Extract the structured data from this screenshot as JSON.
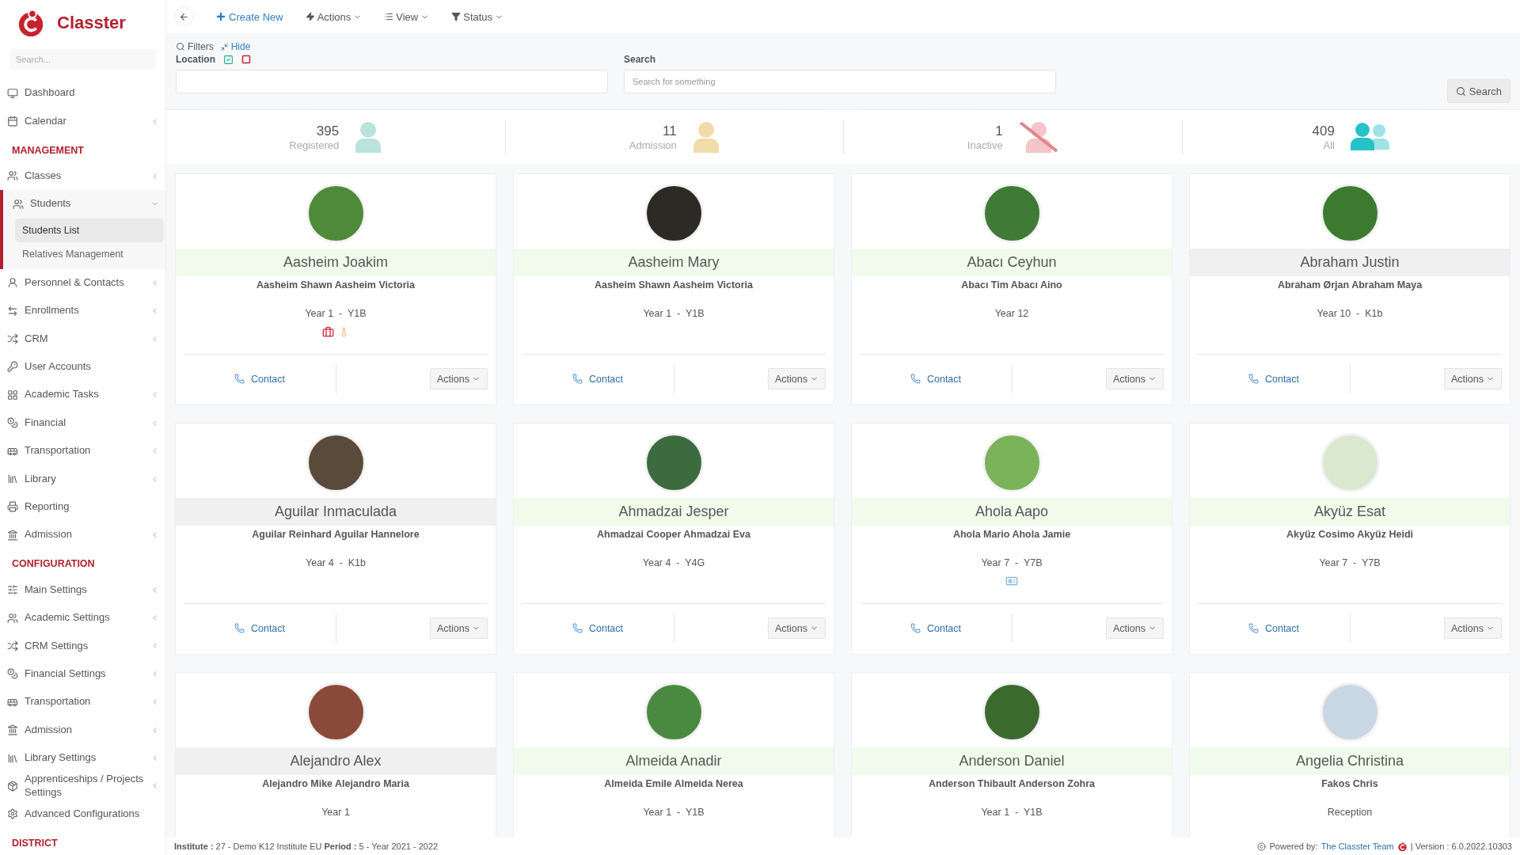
{
  "sidebar": {
    "brand": "Classter",
    "search_placeholder": "Search...",
    "sections": [
      {
        "items": [
          {
            "label": "Dashboard",
            "selected": false
          },
          {
            "label": "Calendar",
            "selected": false,
            "expanded": false
          }
        ]
      },
      {
        "heading": "MANAGEMENT",
        "items": [
          {
            "label": "Classes",
            "selected": false,
            "expanded": false
          },
          {
            "label": "Students",
            "selected": true,
            "expanded": true,
            "children": [
              {
                "label": "Students List",
                "selected": true
              },
              {
                "label": "Relatives Management",
                "selected": false
              }
            ]
          },
          {
            "label": "Personnel & Contacts",
            "selected": false,
            "expanded": false
          },
          {
            "label": "Enrollments",
            "selected": false,
            "expanded": false
          },
          {
            "label": "CRM",
            "selected": false,
            "expanded": false
          },
          {
            "label": "User Accounts",
            "selected": false
          },
          {
            "label": "Academic Tasks",
            "selected": false,
            "expanded": false
          },
          {
            "label": "Financial",
            "selected": false,
            "expanded": false
          },
          {
            "label": "Transportation",
            "selected": false,
            "expanded": false
          },
          {
            "label": "Library",
            "selected": false,
            "expanded": false
          },
          {
            "label": "Reporting",
            "selected": false
          },
          {
            "label": "Admission",
            "selected": false,
            "expanded": false
          }
        ]
      },
      {
        "heading": "CONFIGURATION",
        "items": [
          {
            "label": "Main Settings",
            "selected": false,
            "expanded": false
          },
          {
            "label": "Academic Settings",
            "selected": false,
            "expanded": false
          },
          {
            "label": "CRM Settings",
            "selected": false,
            "expanded": false
          },
          {
            "label": "Financial Settings",
            "selected": false,
            "expanded": false
          },
          {
            "label": "Transportation",
            "selected": false,
            "expanded": false
          },
          {
            "label": "Admission",
            "selected": false,
            "expanded": false
          },
          {
            "label": "Library Settings",
            "selected": false,
            "expanded": false
          },
          {
            "label": "Apprenticeships / Projects Settings",
            "selected": false,
            "expanded": false
          },
          {
            "label": "Advanced Configurations",
            "selected": false
          }
        ]
      },
      {
        "heading": "DISTRICT"
      }
    ]
  },
  "toolbar": {
    "create": "Create New",
    "menus": [
      "Actions",
      "View",
      "Status"
    ]
  },
  "filters": {
    "title": "Filters",
    "hide": "Hide",
    "location_label": "Location",
    "search_label": "Search",
    "search_placeholder": "Search for something",
    "search_button": "Search"
  },
  "stats": [
    {
      "value": "395",
      "label": "Registered",
      "kind": "single",
      "color": "#b9e3dc"
    },
    {
      "value": "11",
      "label": "Admission",
      "kind": "single",
      "color": "#f0dca8"
    },
    {
      "value": "1",
      "label": "Inactive",
      "kind": "slashed",
      "color": "#f4c4c8"
    },
    {
      "value": "409",
      "label": "All",
      "kind": "group",
      "color": "#26c2c9"
    }
  ],
  "cards": [
    {
      "name": "Aasheim Joakim",
      "parents": "Aasheim Shawn Aasheim Victoria",
      "class": "Year 1  -  Y1B",
      "color": "#f1fbec",
      "medical": true,
      "thermometer": true,
      "id_card": false,
      "contact": "Contact",
      "actions": "Actions"
    },
    {
      "name": "Aasheim Mary",
      "parents": "Aasheim Shawn Aasheim Victoria",
      "class": "Year 1  -  Y1B",
      "color": "#f1fbec",
      "contact": "Contact",
      "actions": "Actions"
    },
    {
      "name": "Abacı Ceyhun",
      "parents": "Abacı Tim Abacı Aino",
      "class": "Year 12",
      "color": "#f1fbec",
      "contact": "Contact",
      "actions": "Actions"
    },
    {
      "name": "Abraham Justin",
      "parents": "Abraham Ørjan Abraham Maya",
      "class": "Year 10  -  K1b",
      "color": "#f0f0f0",
      "contact": "Contact",
      "actions": "Actions"
    },
    {
      "name": "Aguilar Inmaculada",
      "parents": "Aguilar Reinhard Aguilar Hannelore",
      "class": "Year 4  -  K1b",
      "color": "#f0f0f0",
      "contact": "Contact",
      "actions": "Actions"
    },
    {
      "name": "Ahmadzai Jesper",
      "parents": "Ahmadzai Cooper Ahmadzai Eva",
      "class": "Year 4  -  Y4G",
      "color": "#f1fbec",
      "contact": "Contact",
      "actions": "Actions"
    },
    {
      "name": "Ahola Aapo",
      "parents": "Ahola Mario Ahola Jamie",
      "class": "Year 7  -  Y7B",
      "color": "#f1fbec",
      "medical": false,
      "thermometer": false,
      "id_card": true,
      "contact": "Contact",
      "actions": "Actions"
    },
    {
      "name": "Akyüz Esat",
      "parents": "Akyüz Cosimo Akyüz Heidi",
      "class": "Year 7  -  Y7B",
      "color": "#f1fbec",
      "contact": "Contact",
      "actions": "Actions"
    },
    {
      "name": "Alejandro Alex",
      "parents": "Alejandro Mike Alejandro Maria",
      "class": "Year 1",
      "color": "#f0f0f0"
    },
    {
      "name": "Almeida Anadir",
      "parents": "Almeida Emile Almeida Nerea",
      "class": "Year 1  -  Y1B",
      "color": "#f1fbec"
    },
    {
      "name": "Anderson Daniel",
      "parents": "Anderson Thibault Anderson Zohra",
      "class": "Year 1  -  Y1B",
      "color": "#f1fbec"
    },
    {
      "name": "Angelia Christina",
      "parents": "Fakos Chris",
      "class": "Reception",
      "color": "#f1fbec"
    }
  ],
  "footer": {
    "info": "**Institute :** 27 - Demo K12 Institute EU **Period :** 5 - Year 2021 - 2022",
    "powered": "Powered by:",
    "team": "The Classter Team",
    "version": "| Version : 6.0.2022.10303"
  }
}
